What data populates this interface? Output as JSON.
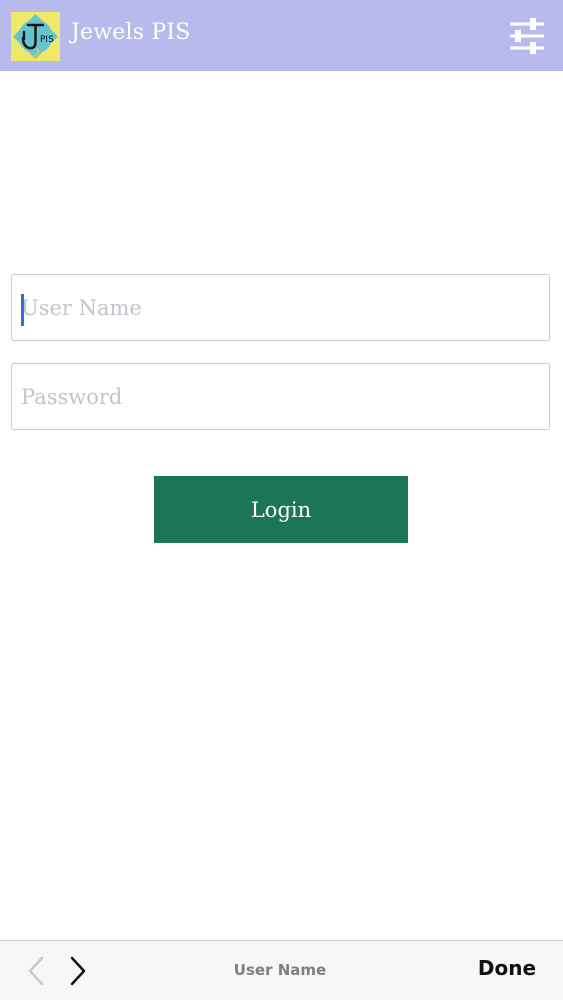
{
  "header": {
    "title": "Jewels PIS",
    "logo_text": "PIS",
    "logo_icon": "jewels-pis-logo",
    "settings_icon": "sliders-icon",
    "background_color": "#b8b9ec"
  },
  "login_form": {
    "username_placeholder": "User Name",
    "username_value": "",
    "password_placeholder": "Password",
    "password_value": "",
    "login_label": "Login",
    "login_button_color": "#1c7558"
  },
  "keyboard_accessory": {
    "prev_icon": "chevron-left-icon",
    "next_icon": "chevron-right-icon",
    "current_field_label": "User Name",
    "done_label": "Done"
  }
}
